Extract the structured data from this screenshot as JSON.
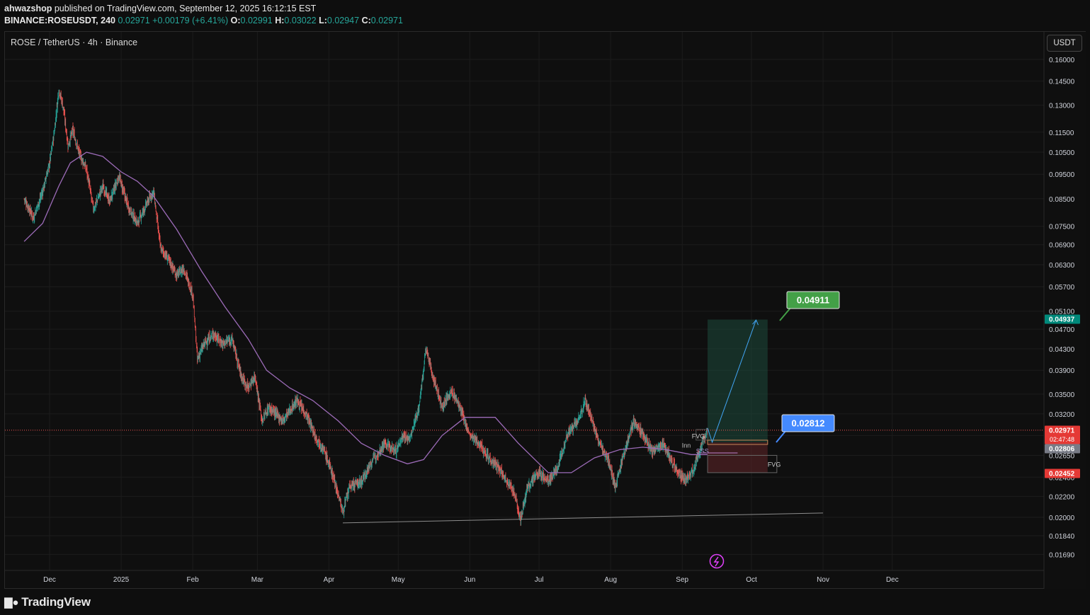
{
  "header": {
    "publisher_user": "ahwazshop",
    "publisher_text": " published on TradingView.com, September 12, 2025 16:12:15 EST",
    "symbol": "BINANCE:ROSEUSDT, 240",
    "last": "0.02971",
    "change": "+0.00179 (+6.41%)",
    "o_label": "O:",
    "o": "0.02991",
    "h_label": "H:",
    "h": "0.03022",
    "l_label": "L:",
    "l": "0.02947",
    "c_label": "C:",
    "c": "0.02971"
  },
  "legend_title": "ROSE / TetherUS · 4h · Binance",
  "currency_button": "USDT",
  "brand": "TradingView",
  "brand_icon": "tradingview-logo-icon",
  "colors": {
    "up": "#26a69a",
    "down": "#ef5350",
    "ma": "#9c6bb8",
    "target_zone": "#1e4a3d",
    "stop_zone": "#5a2326",
    "annot_green": "#43a047",
    "annot_blue": "#448aff"
  },
  "chart_data": {
    "type": "candlestick",
    "title": "ROSE / TetherUS · 4h · Binance",
    "y_scale": "log",
    "x_axis_ticks": [
      "Dec",
      "2025",
      "Feb",
      "Mar",
      "Apr",
      "May",
      "Jun",
      "Jul",
      "Aug",
      "Sep",
      "Oct",
      "Nov",
      "Dec"
    ],
    "y_axis_ticks": [
      "0.16000",
      "0.14500",
      "0.13000",
      "0.11500",
      "0.10500",
      "0.09500",
      "0.08500",
      "0.07500",
      "0.06900",
      "0.06300",
      "0.05700",
      "0.05100",
      "0.04700",
      "0.04300",
      "0.03900",
      "0.03500",
      "0.03200",
      "0.02900",
      "0.02650",
      "0.02400",
      "0.02200",
      "0.02000",
      "0.01840",
      "0.01690"
    ],
    "series": [
      {
        "name": "price",
        "type": "candlestick",
        "close_path": [
          [
            "2024-11-20",
            0.085
          ],
          [
            "2024-11-24",
            0.078
          ],
          [
            "2024-11-28",
            0.088
          ],
          [
            "2024-12-01",
            0.1
          ],
          [
            "2024-12-03",
            0.115
          ],
          [
            "2024-12-05",
            0.14
          ],
          [
            "2024-12-07",
            0.128
          ],
          [
            "2024-12-09",
            0.108
          ],
          [
            "2024-12-11",
            0.116
          ],
          [
            "2024-12-14",
            0.104
          ],
          [
            "2024-12-17",
            0.097
          ],
          [
            "2024-12-20",
            0.081
          ],
          [
            "2024-12-24",
            0.09
          ],
          [
            "2024-12-27",
            0.084
          ],
          [
            "2024-12-31",
            0.094
          ],
          [
            "2025-01-04",
            0.082
          ],
          [
            "2025-01-08",
            0.076
          ],
          [
            "2025-01-12",
            0.083
          ],
          [
            "2025-01-15",
            0.088
          ],
          [
            "2025-01-18",
            0.068
          ],
          [
            "2025-01-22",
            0.064
          ],
          [
            "2025-01-25",
            0.06
          ],
          [
            "2025-01-28",
            0.062
          ],
          [
            "2025-02-01",
            0.055
          ],
          [
            "2025-02-03",
            0.041
          ],
          [
            "2025-02-06",
            0.044
          ],
          [
            "2025-02-10",
            0.046
          ],
          [
            "2025-02-14",
            0.044
          ],
          [
            "2025-02-18",
            0.045
          ],
          [
            "2025-02-22",
            0.038
          ],
          [
            "2025-02-25",
            0.036
          ],
          [
            "2025-02-28",
            0.038
          ],
          [
            "2025-03-03",
            0.031
          ],
          [
            "2025-03-06",
            0.033
          ],
          [
            "2025-03-12",
            0.031
          ],
          [
            "2025-03-18",
            0.034
          ],
          [
            "2025-03-22",
            0.032
          ],
          [
            "2025-03-26",
            0.029
          ],
          [
            "2025-03-30",
            0.027
          ],
          [
            "2025-04-03",
            0.024
          ],
          [
            "2025-04-07",
            0.0205
          ],
          [
            "2025-04-10",
            0.023
          ],
          [
            "2025-04-15",
            0.0235
          ],
          [
            "2025-04-20",
            0.026
          ],
          [
            "2025-04-25",
            0.028
          ],
          [
            "2025-04-30",
            0.027
          ],
          [
            "2025-05-03",
            0.029
          ],
          [
            "2025-05-06",
            0.0285
          ],
          [
            "2025-05-10",
            0.033
          ],
          [
            "2025-05-13",
            0.043
          ],
          [
            "2025-05-16",
            0.038
          ],
          [
            "2025-05-20",
            0.033
          ],
          [
            "2025-05-24",
            0.0355
          ],
          [
            "2025-05-27",
            0.0335
          ],
          [
            "2025-06-01",
            0.029
          ],
          [
            "2025-06-05",
            0.028
          ],
          [
            "2025-06-10",
            0.026
          ],
          [
            "2025-06-15",
            0.0245
          ],
          [
            "2025-06-20",
            0.0225
          ],
          [
            "2025-06-23",
            0.0198
          ],
          [
            "2025-06-26",
            0.023
          ],
          [
            "2025-07-01",
            0.0245
          ],
          [
            "2025-07-05",
            0.0235
          ],
          [
            "2025-07-09",
            0.025
          ],
          [
            "2025-07-13",
            0.029
          ],
          [
            "2025-07-18",
            0.031
          ],
          [
            "2025-07-21",
            0.034
          ],
          [
            "2025-07-24",
            0.031
          ],
          [
            "2025-07-27",
            0.028
          ],
          [
            "2025-07-31",
            0.026
          ],
          [
            "2025-08-03",
            0.023
          ],
          [
            "2025-08-07",
            0.027
          ],
          [
            "2025-08-11",
            0.031
          ],
          [
            "2025-08-15",
            0.029
          ],
          [
            "2025-08-19",
            0.027
          ],
          [
            "2025-08-24",
            0.028
          ],
          [
            "2025-08-28",
            0.0255
          ],
          [
            "2025-09-02",
            0.0235
          ],
          [
            "2025-09-06",
            0.025
          ],
          [
            "2025-09-09",
            0.0275
          ],
          [
            "2025-09-12",
            0.02971
          ]
        ]
      },
      {
        "name": "moving-average",
        "type": "line",
        "points": [
          [
            "2024-11-20",
            0.07
          ],
          [
            "2024-11-28",
            0.076
          ],
          [
            "2024-12-05",
            0.09
          ],
          [
            "2024-12-10",
            0.1
          ],
          [
            "2024-12-17",
            0.105
          ],
          [
            "2024-12-24",
            0.103
          ],
          [
            "2025-01-01",
            0.096
          ],
          [
            "2025-01-08",
            0.092
          ],
          [
            "2025-01-15",
            0.086
          ],
          [
            "2025-01-25",
            0.074
          ],
          [
            "2025-02-05",
            0.061
          ],
          [
            "2025-02-15",
            0.052
          ],
          [
            "2025-02-25",
            0.045
          ],
          [
            "2025-03-05",
            0.039
          ],
          [
            "2025-03-15",
            0.036
          ],
          [
            "2025-03-25",
            0.034
          ],
          [
            "2025-04-05",
            0.031
          ],
          [
            "2025-04-15",
            0.028
          ],
          [
            "2025-04-25",
            0.0265
          ],
          [
            "2025-05-05",
            0.0255
          ],
          [
            "2025-05-12",
            0.026
          ],
          [
            "2025-05-20",
            0.029
          ],
          [
            "2025-05-30",
            0.0315
          ],
          [
            "2025-06-12",
            0.0315
          ],
          [
            "2025-06-22",
            0.028
          ],
          [
            "2025-07-05",
            0.0245
          ],
          [
            "2025-07-15",
            0.0245
          ],
          [
            "2025-07-25",
            0.0262
          ],
          [
            "2025-08-05",
            0.0272
          ],
          [
            "2025-08-15",
            0.0275
          ],
          [
            "2025-08-25",
            0.0272
          ],
          [
            "2025-09-05",
            0.0266
          ],
          [
            "2025-09-12",
            0.0266
          ]
        ]
      }
    ],
    "trendline": {
      "from": [
        "2025-04-07",
        0.0195
      ],
      "to": [
        "2025-11-01",
        0.0204
      ]
    },
    "position": {
      "entry": 0.02812,
      "target": 0.04911,
      "stop": 0.02452,
      "start": "2025-09-12",
      "end": "2025-10-08"
    },
    "annotations": {
      "target_label": "0.04911",
      "entry_label": "0.02812",
      "fvg_upper": "FVG",
      "fvg_lower": "FVG",
      "inner_label": "Inn",
      "sss_label": "SSS"
    },
    "price_labels": [
      {
        "value": "0.04937",
        "color": "#00897b"
      },
      {
        "value": "0.02971",
        "countdown": "02:47:48",
        "color": "#e53935"
      },
      {
        "value": "0.02806",
        "color": "#787b86"
      },
      {
        "value": "0.02452",
        "color": "#e53935"
      }
    ],
    "event_icon": "lightning-icon",
    "grid": true
  }
}
